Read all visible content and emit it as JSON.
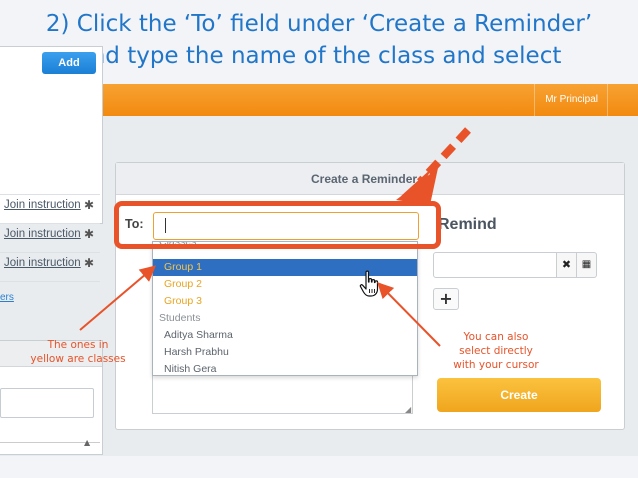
{
  "headline": {
    "line1": "2) Click the ‘To’ field under ‘Create a Reminder’",
    "line2": "and type the name of the class and select"
  },
  "topbar": {
    "user": "Mr Principal",
    "brand_color": "#f28a0f"
  },
  "left_panel": {
    "add_label": "Add",
    "rows": [
      {
        "label": "Join instruction",
        "icon": "gear-icon"
      },
      {
        "label": "Join instruction",
        "icon": "gear-icon"
      },
      {
        "label": "Join instruction",
        "icon": "gear-icon"
      }
    ],
    "link_fragment": "ers"
  },
  "create_reminder": {
    "title": "Create a Reminder",
    "to_label": "To:",
    "to_value": "",
    "remind_title": "Remind",
    "clear_icon": "✖",
    "grid_icon": "▦",
    "plus_label": "+",
    "create_label": "Create"
  },
  "dropdown": {
    "classes_header": "Classes",
    "classes": [
      "Group 1",
      "Group 2",
      "Group 3"
    ],
    "selected": "Group 1",
    "students_header": "Students",
    "students": [
      "Aditya Sharma",
      "Harsh Prabhu",
      "Nitish Gera"
    ]
  },
  "annotations": {
    "left_note": "The ones in\nyellow are classes",
    "right_note": "You can also\nselect directly\nwith your cursor",
    "color": "#e8532a"
  }
}
